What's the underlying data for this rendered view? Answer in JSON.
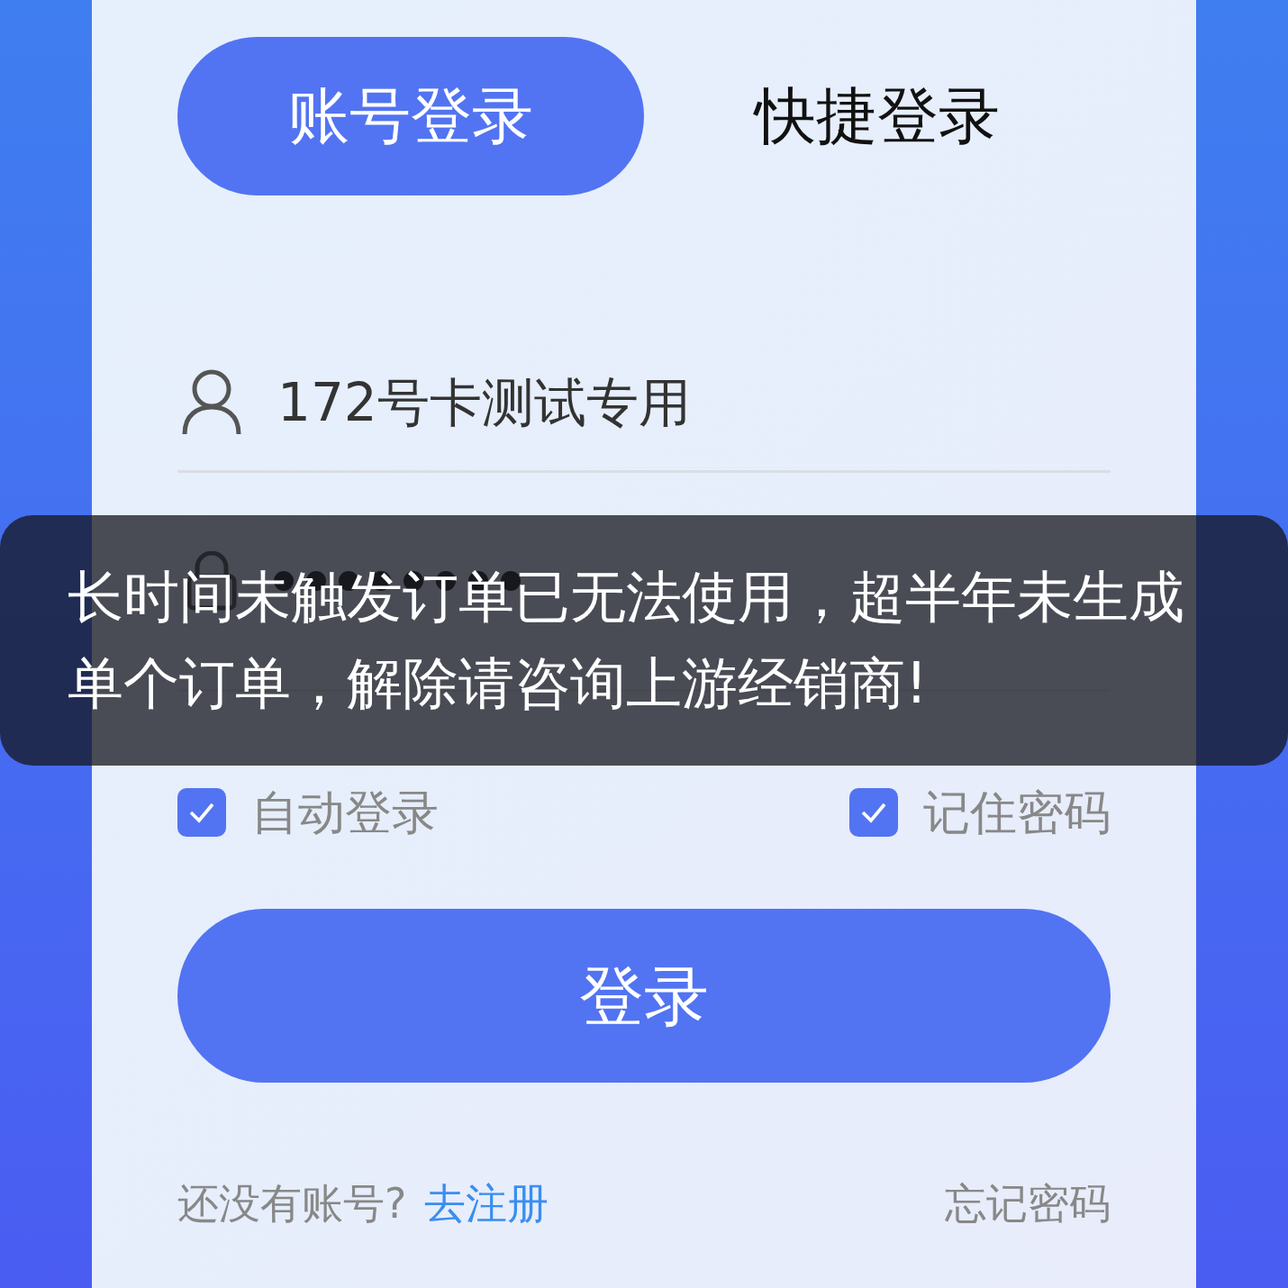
{
  "tabs": [
    {
      "label": "账号登录",
      "selected": true
    },
    {
      "label": "快捷登录",
      "selected": false
    }
  ],
  "username": {
    "value": "172号卡测试专用"
  },
  "options": [
    {
      "label": "自动登录",
      "checked": true
    },
    {
      "label": "记住密码",
      "checked": true
    }
  ],
  "login_button": "登录",
  "footer": {
    "prompt": "还没有账号?",
    "register_link": "去注册",
    "forgot_link": "忘记密码"
  },
  "toast": "长时间未触发订单已无法使用，超半年未生成单个订单，解除请咨询上游经销商!"
}
